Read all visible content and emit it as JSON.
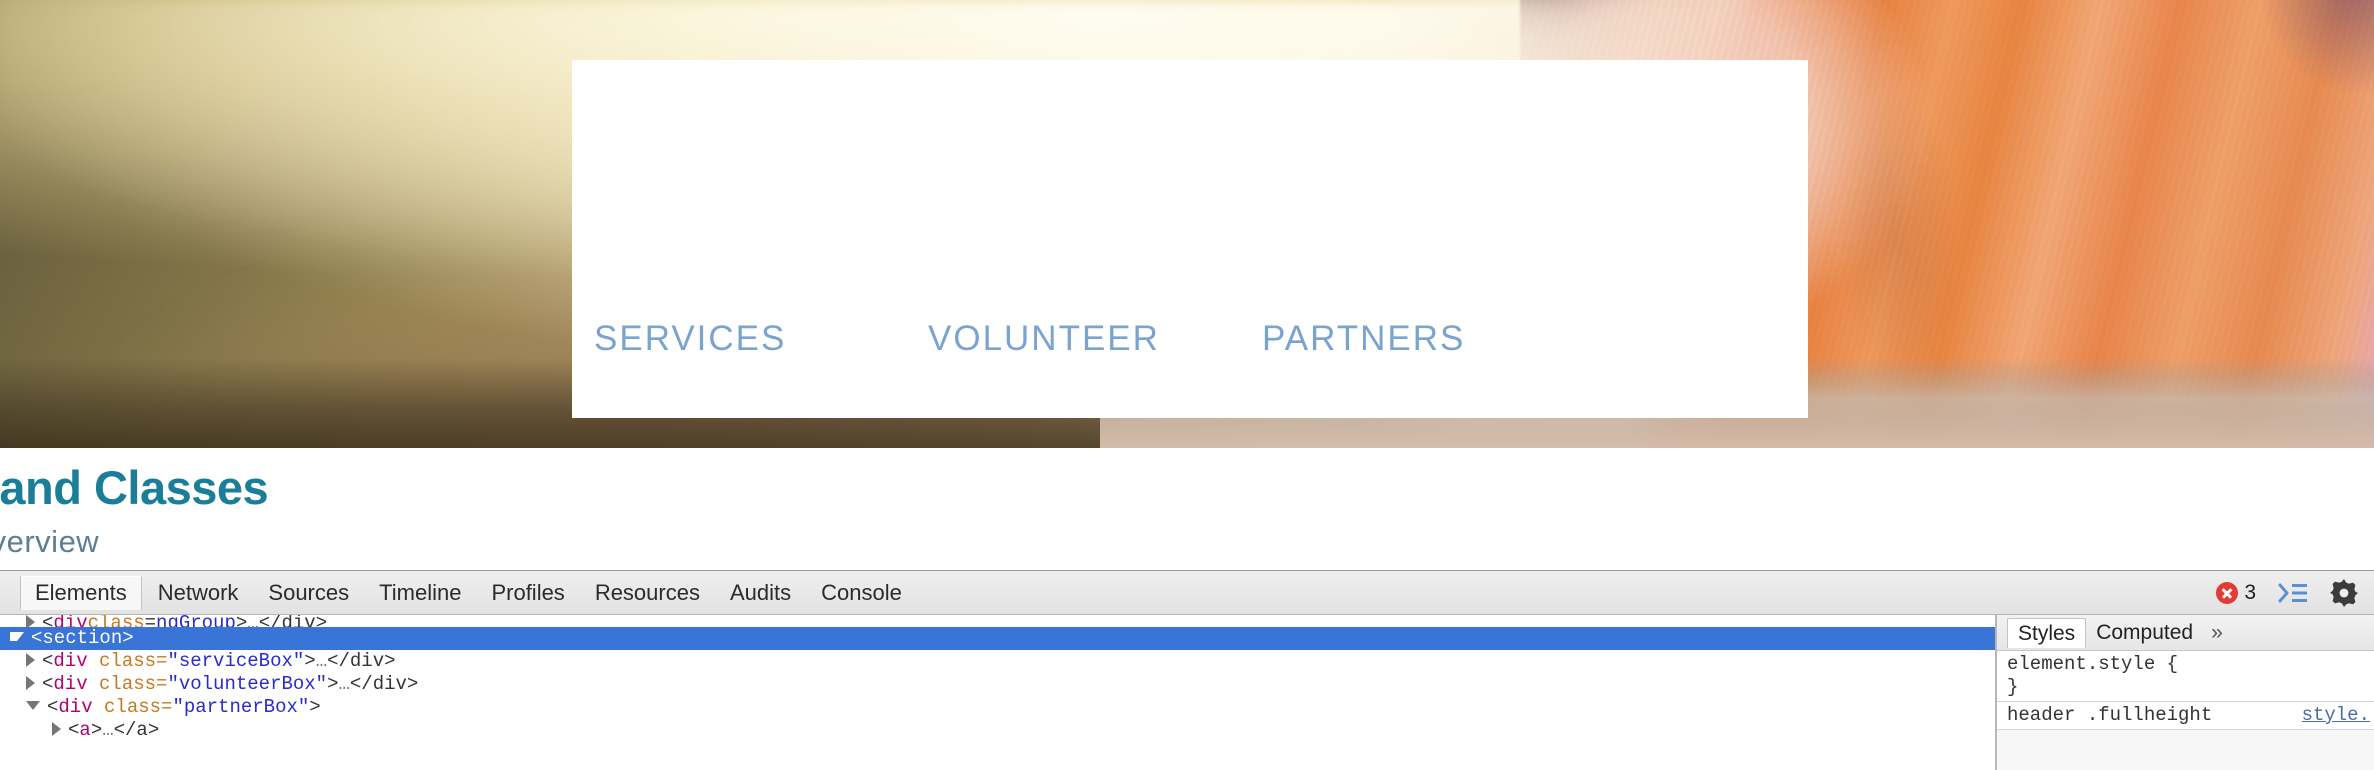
{
  "page": {
    "nav_links": [
      "SERVICES",
      "VOLUNTEER",
      "PARTNERS"
    ],
    "title": "ts and Classes",
    "subtitle": "Overview"
  },
  "devtools": {
    "tabs": [
      {
        "label": "Elements",
        "active": true
      },
      {
        "label": "Network",
        "active": false
      },
      {
        "label": "Sources",
        "active": false
      },
      {
        "label": "Timeline",
        "active": false
      },
      {
        "label": "Profiles",
        "active": false
      },
      {
        "label": "Resources",
        "active": false
      },
      {
        "label": "Audits",
        "active": false
      },
      {
        "label": "Console",
        "active": false
      }
    ],
    "error_count": "3",
    "icons": {
      "error": "error-circle-icon",
      "drawer": "show-drawer-icon",
      "settings": "gear-icon"
    },
    "dom": {
      "clipped_row": {
        "tag": "div",
        "attr": "class",
        "value": "ngGroup"
      },
      "rows": [
        {
          "indent": 0,
          "marker": "open",
          "open_tag": "<section>",
          "selected": true
        },
        {
          "indent": 1,
          "marker": "closed",
          "open_tag_lt": "<",
          "tag": "div",
          "attr": " class=",
          "value": "\"serviceBox\"",
          "gt": ">",
          "ellipsis": "…",
          "close_tag": "</div>",
          "selected": false
        },
        {
          "indent": 1,
          "marker": "closed",
          "open_tag_lt": "<",
          "tag": "div",
          "attr": " class=",
          "value": "\"volunteerBox\"",
          "gt": ">",
          "ellipsis": "…",
          "close_tag": "</div>",
          "selected": false
        },
        {
          "indent": 1,
          "marker": "open",
          "open_tag_lt": "<",
          "tag": "div",
          "attr": " class=",
          "value": "\"partnerBox\"",
          "gt": ">",
          "ellipsis": "",
          "close_tag": "",
          "selected": false
        },
        {
          "indent": 2,
          "marker": "closed",
          "open_tag_lt": "<",
          "tag": "a",
          "attr": "",
          "value": "",
          "gt": ">",
          "ellipsis": "…",
          "close_tag": "</a>",
          "selected": false
        }
      ]
    },
    "styles": {
      "tabs": [
        {
          "label": "Styles",
          "active": true
        },
        {
          "label": "Computed",
          "active": false
        }
      ],
      "more": "»",
      "element_style_open": "element.style {",
      "element_style_close": "}",
      "rule_selector": "header .fullheight",
      "rule_origin": "style."
    }
  },
  "colors": {
    "heading": "#1b7e99",
    "subheading": "#5e7e93",
    "nav_link": "#7ba3d0",
    "selection": "#3875d7",
    "error": "#e23b33"
  }
}
